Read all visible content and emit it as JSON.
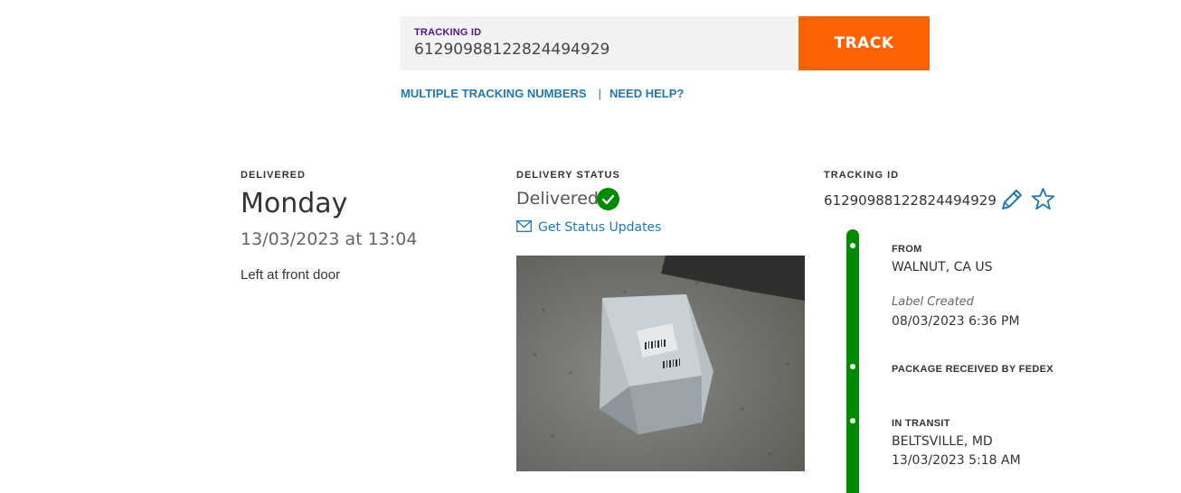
{
  "search": {
    "label": "TRACKING ID",
    "value": "61290988122824494929",
    "button_label": "TRACK",
    "links": [
      "MULTIPLE TRACKING NUMBERS",
      "NEED HELP?"
    ]
  },
  "delivered": {
    "heading": "DELIVERED",
    "day": "Monday",
    "datetime": "13/03/2023 at 13:04",
    "note": "Left at front door"
  },
  "status": {
    "heading": "DELIVERY STATUS",
    "value": "Delivered",
    "updates_link": "Get Status Updates"
  },
  "tracking": {
    "heading": "TRACKING ID",
    "number": "61290988122824494929"
  },
  "timeline": {
    "from_heading": "FROM",
    "from_location": "WALNUT, CA US",
    "label_created": "Label Created",
    "label_created_date": "08/03/2023 6:36 PM",
    "received_heading": "PACKAGE RECEIVED BY FEDEX",
    "transit_heading": "IN TRANSIT",
    "transit_location": "BELTSVILLE, MD",
    "transit_date": "13/03/2023 5:18 AM"
  },
  "colors": {
    "accent_orange": "#ff6200",
    "brand_purple": "#4d148c",
    "link_blue": "#1f78b4",
    "success_green": "#008a00"
  },
  "icons": [
    "mail-icon",
    "check-circle-icon",
    "pencil-icon",
    "star-icon"
  ]
}
